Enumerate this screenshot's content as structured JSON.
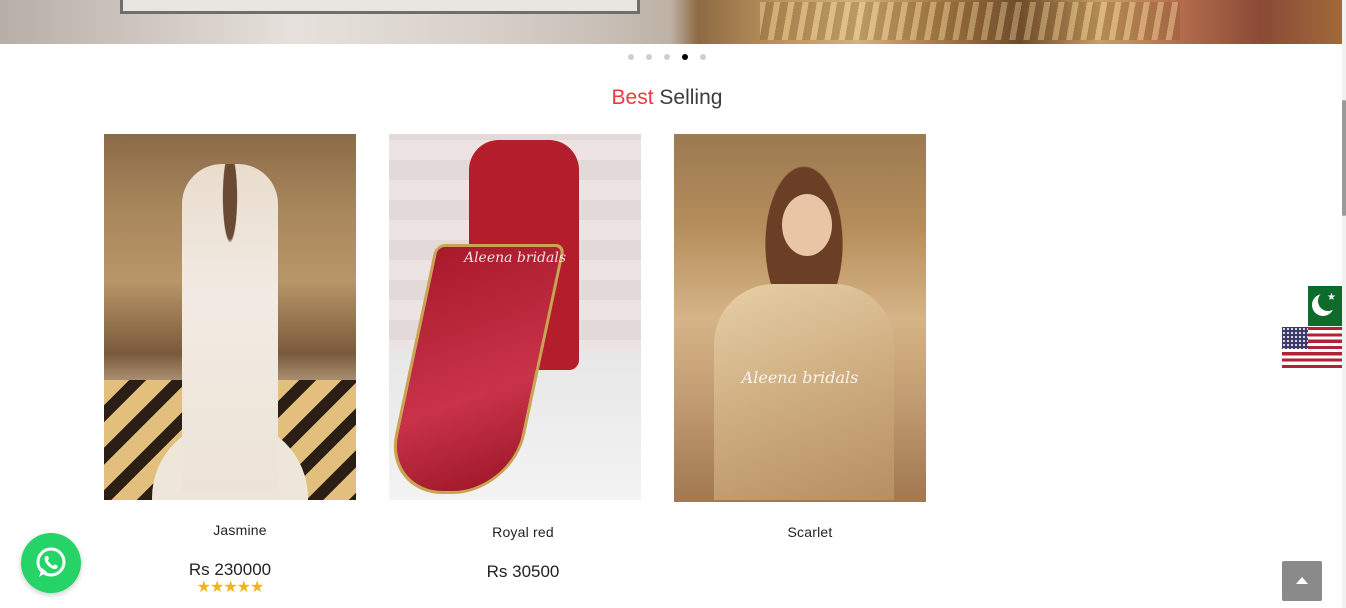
{
  "carousel": {
    "slides": 5,
    "active_index": 3
  },
  "section": {
    "title_accent": "Best",
    "title_rest": "Selling"
  },
  "products": [
    {
      "name": "Jasmine",
      "price": "Rs 230000",
      "rating": 5,
      "watermark": ""
    },
    {
      "name": "Royal red",
      "price": "Rs 30500",
      "rating": null,
      "watermark": "Aleena bridals"
    },
    {
      "name": "Scarlet",
      "price": "",
      "rating": null,
      "watermark": "Aleena bridals"
    }
  ],
  "stars_text": "★★★★★",
  "icons": {
    "whatsapp": "whatsapp-icon",
    "back_to_top": "chevron-up-icon",
    "flag_pk": "pakistan-flag-icon",
    "flag_us": "usa-flag-icon"
  },
  "colors": {
    "accent": "#e83a3a",
    "whatsapp": "#25d366"
  }
}
